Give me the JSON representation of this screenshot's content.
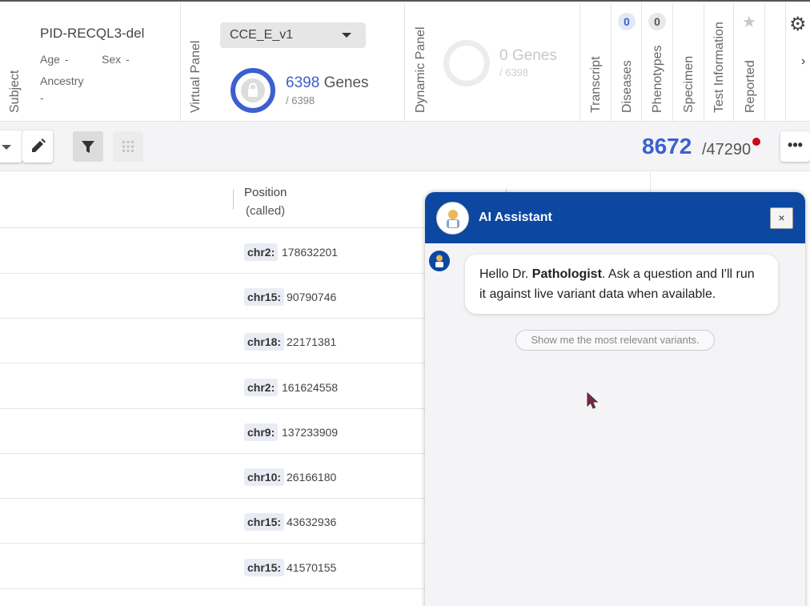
{
  "header": {
    "subject": {
      "section_label": "Subject",
      "id": "PID-RECQL3-del",
      "age_label": "Age",
      "age_value": "-",
      "sex_label": "Sex",
      "sex_value": "-",
      "ancestry_label": "Ancestry",
      "ancestry_value": "-"
    },
    "virtual_panel": {
      "section_label": "Virtual Panel",
      "selected": "CCE_E_v1",
      "genes_count": "6398",
      "genes_word": "Genes",
      "genes_total": "/ 6398"
    },
    "dynamic_panel": {
      "section_label": "Dynamic Panel",
      "genes_count": "0 Genes",
      "genes_total": "/ 6398"
    },
    "tabs": [
      {
        "label": "Transcript"
      },
      {
        "label": "Diseases",
        "badge": "0"
      },
      {
        "label": "Phenotypes",
        "badge": "0"
      },
      {
        "label": "Specimen"
      },
      {
        "label": "Test Information"
      },
      {
        "label": "Reported"
      }
    ]
  },
  "toolbar": {
    "filtered_count": "8672",
    "total_count": "/47290"
  },
  "table": {
    "position_header": "Position",
    "position_subheader": "(called)",
    "rows": [
      {
        "chr": "chr2:",
        "pos": "178632201"
      },
      {
        "chr": "chr15:",
        "pos": "90790746"
      },
      {
        "chr": "chr18:",
        "pos": "22171381"
      },
      {
        "chr": "chr2:",
        "pos": "161624558"
      },
      {
        "chr": "chr9:",
        "pos": "137233909"
      },
      {
        "chr": "chr10:",
        "pos": "26166180"
      },
      {
        "chr": "chr15:",
        "pos": "43632936"
      },
      {
        "chr": "chr15:",
        "pos": "41570155"
      }
    ]
  },
  "assistant": {
    "title": "AI Assistant",
    "close_label": "×",
    "greeting_prefix": "Hello Dr. ",
    "greeting_name": "Pathologist",
    "greeting_suffix": ". Ask a question and I'll run it against live variant data when available.",
    "suggestion": "Show me the most relevant variants."
  },
  "colors": {
    "accent_blue": "#3d5fd0",
    "assistant_header": "#0c47a1",
    "alert_red": "#d0021b"
  },
  "icons": [
    "lock-icon",
    "settings-gear-icon",
    "chevron-right-icon",
    "star-icon",
    "edit-pencil-icon",
    "filter-icon",
    "grid-icon",
    "more-options-icon",
    "close-icon",
    "assistant-avatar-icon",
    "mouse-cursor-icon"
  ]
}
